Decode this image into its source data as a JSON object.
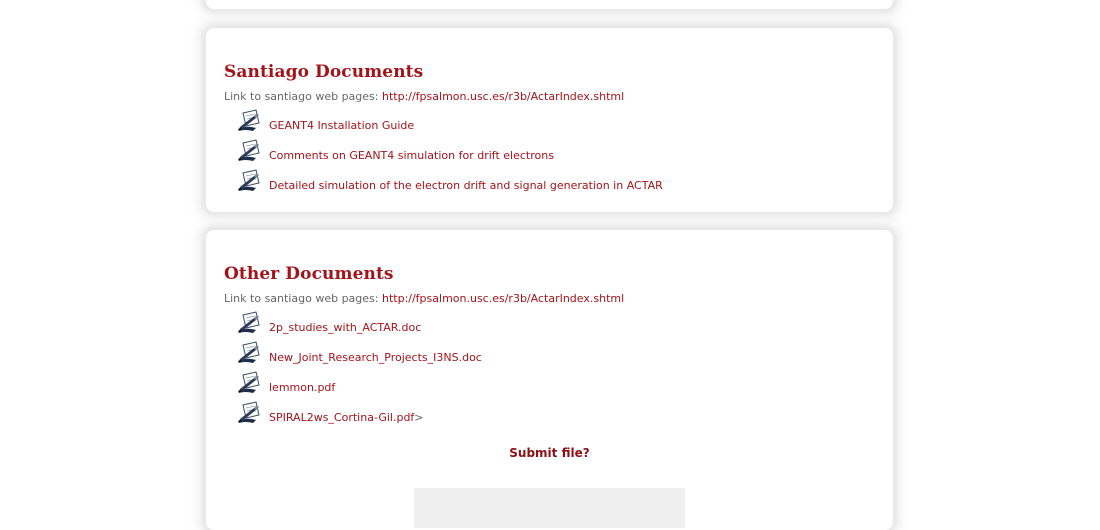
{
  "santiago": {
    "title": "Santiago Documents",
    "intro_label": "Link to santiago web pages: ",
    "intro_link": "http://fpsalmon.usc.es/r3b/ActarIndex.shtml",
    "documents": [
      {
        "label": "GEANT4 Installation Guide"
      },
      {
        "label": "Comments on GEANT4 simulation for drift electrons"
      },
      {
        "label": "Detailed simulation of the electron drift and signal generation in ACTAR"
      }
    ]
  },
  "other": {
    "title": "Other Documents",
    "intro_label": "Link to santiago web pages: ",
    "intro_link": "http://fpsalmon.usc.es/r3b/ActarIndex.shtml",
    "documents": [
      {
        "label": "2p_studies_with_ACTAR.doc"
      },
      {
        "label": "New_Joint_Research_Projects_I3NS.doc"
      },
      {
        "label": "lemmon.pdf"
      },
      {
        "label": "SPIRAL2ws_Cortina-Gil.pdf",
        "suffix": ">"
      }
    ],
    "submit_label": "Submit file?"
  },
  "colors": {
    "accent": "#a3141a",
    "muted_text": "#666666",
    "icon_dark": "#1f2f4a"
  },
  "icons": {
    "document": "document-pen-icon"
  }
}
